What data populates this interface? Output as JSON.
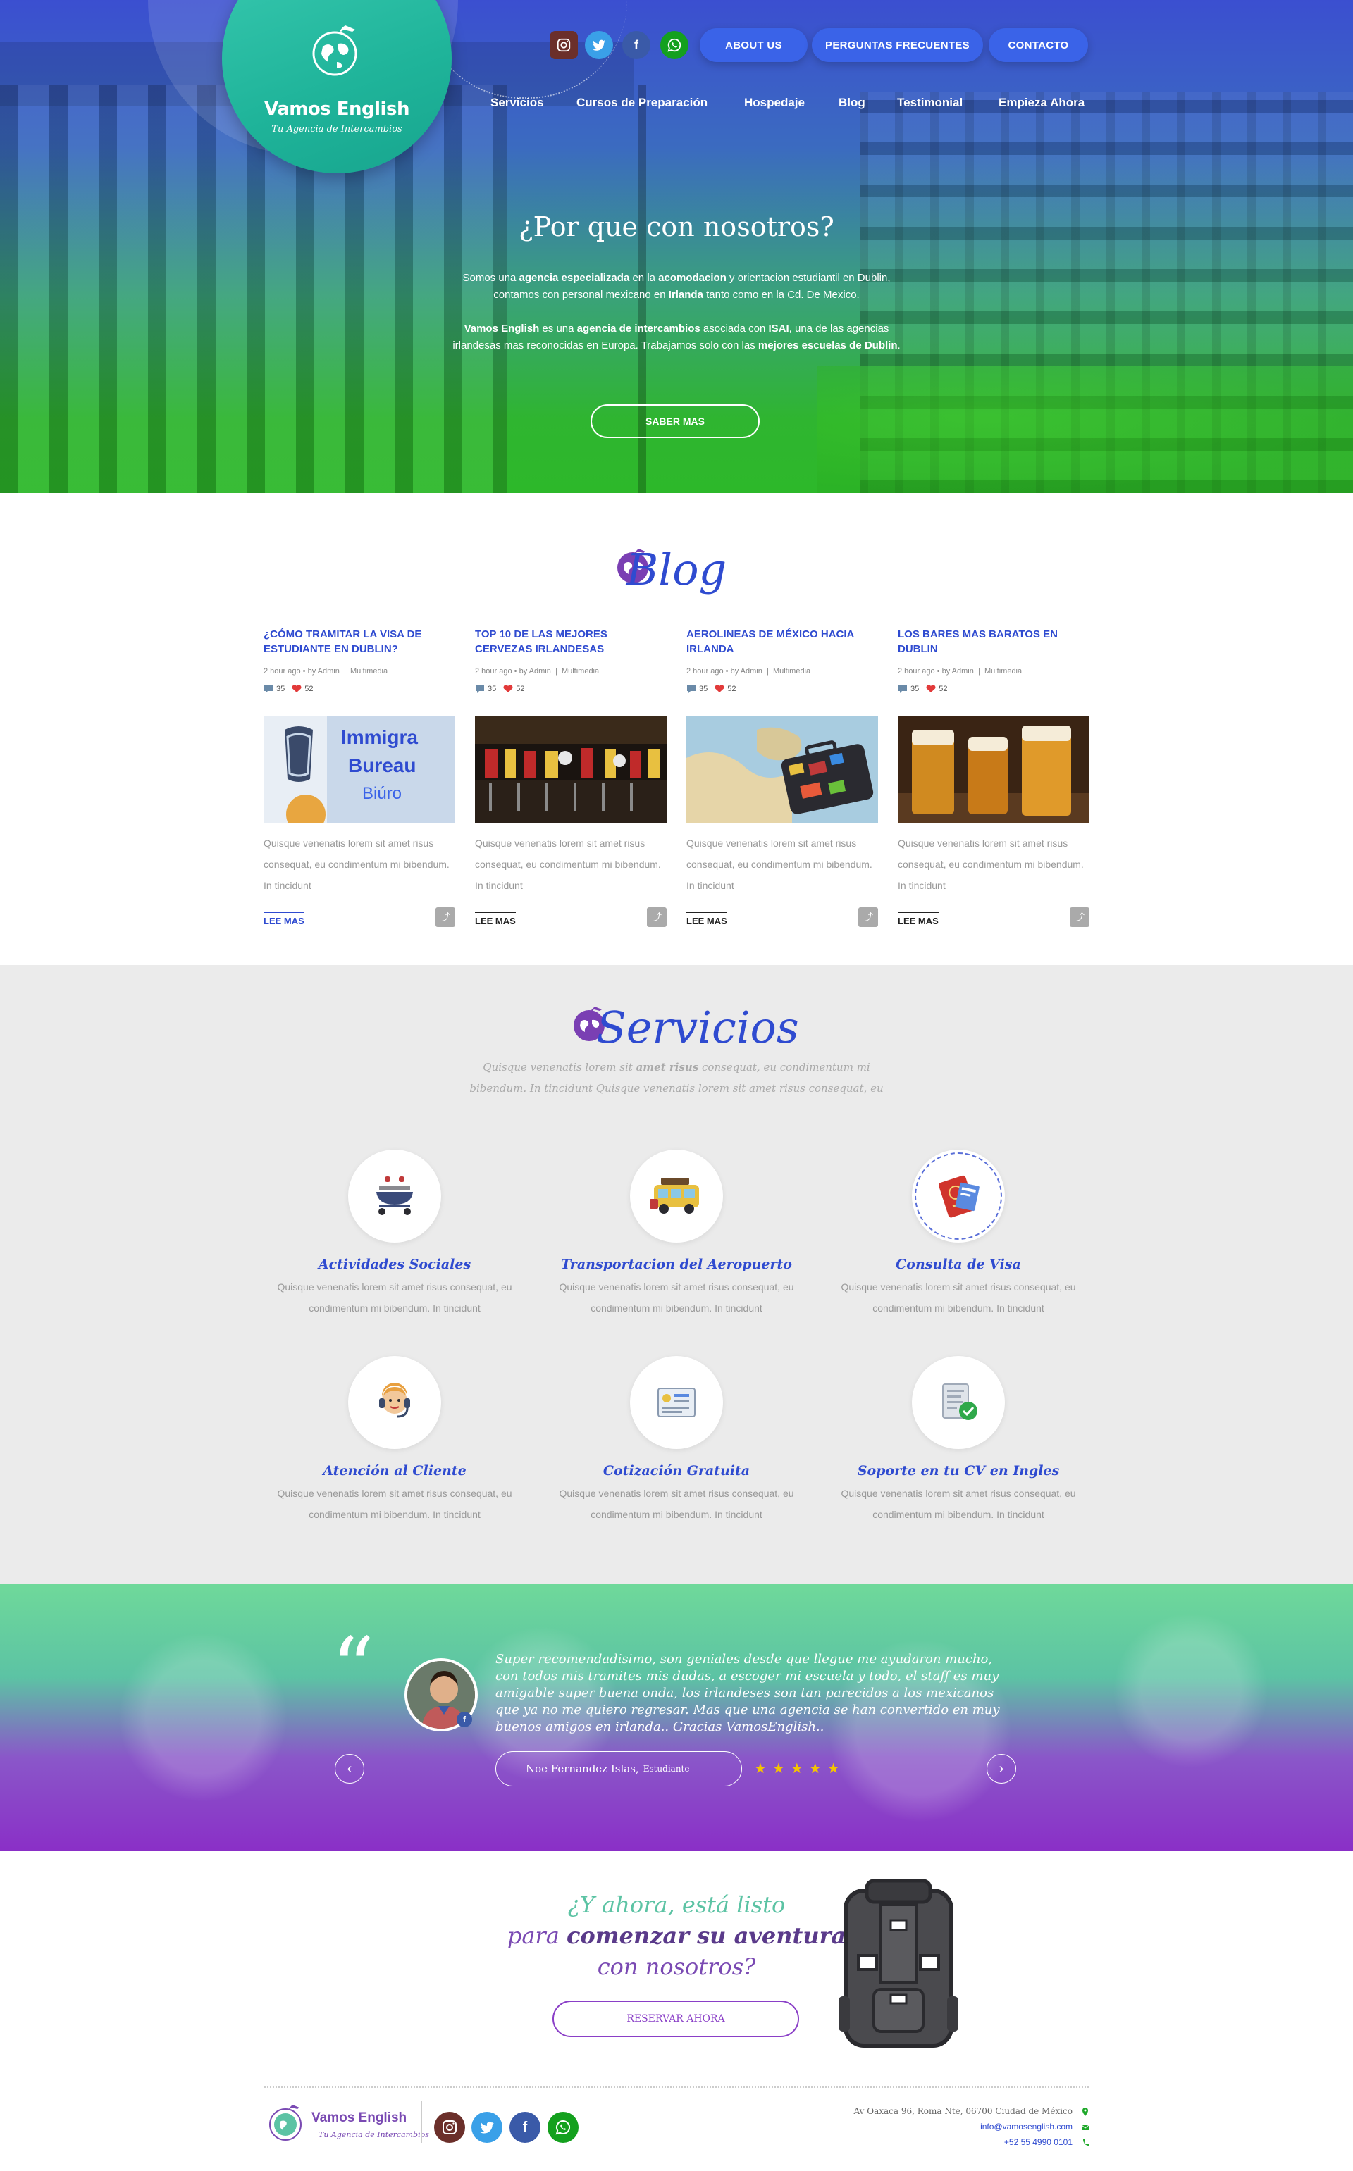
{
  "brand": {
    "name": "Vamos English",
    "tagline": "Tu Agencia de Intercambios"
  },
  "header": {
    "social_icons": [
      "instagram-icon",
      "twitter-icon",
      "facebook-icon",
      "whatsapp-icon"
    ],
    "buttons": {
      "about": "ABOUT US",
      "faq": "PERGUNTAS FRECUENTES",
      "contact": "CONTACTO"
    },
    "nav": [
      "Servicios",
      "Cursos de Preparación",
      "Hospedaje",
      "Blog",
      "Testimonial",
      "Empieza Ahora"
    ]
  },
  "hero": {
    "title": "¿Por que con nosotros?",
    "p1": {
      "parts": [
        "Somos una ",
        "agencia especializada",
        " en la ",
        "acomodacion",
        " y orientacion estudiantil en Dublin, contamos con personal mexicano en ",
        "Irlanda",
        " tanto como en la Cd. De Mexico."
      ]
    },
    "p2": {
      "parts": [
        "Vamos English",
        " es una ",
        "agencia de intercambios",
        " asociada con ",
        "ISAI",
        ", una de las agencias irlandesas mas reconocidas en Europa. Trabajamos solo con las ",
        "mejores escuelas de Dublin",
        "."
      ]
    },
    "button": "SABER MAS"
  },
  "blog": {
    "title": "Blog",
    "posts": [
      {
        "title": "¿CÓMO TRAMITAR LA VISA DE ESTUDIANTE EN DUBLIN?",
        "time": "2 hour ago",
        "by": "by",
        "author": "Admin",
        "category": "Multimedia",
        "comments": "35",
        "likes": "52",
        "excerpt": "Quisque venenatis lorem sit amet risus consequat, eu condimentum mi bibendum. In tincidunt",
        "link": "LEE MAS"
      },
      {
        "title": "TOP 10 DE LAS MEJORES CERVEZAS IRLANDESAS",
        "time": "2 hour ago",
        "by": "by",
        "author": "Admin",
        "category": "Multimedia",
        "comments": "35",
        "likes": "52",
        "excerpt": "Quisque venenatis lorem sit amet risus consequat, eu condimentum mi bibendum. In tincidunt",
        "link": "LEE MAS"
      },
      {
        "title": "AEROLINEAS DE MÉXICO HACIA IRLANDA",
        "time": "2 hour ago",
        "by": "by",
        "author": "Admin",
        "category": "Multimedia",
        "comments": "35",
        "likes": "52",
        "excerpt": "Quisque venenatis lorem sit amet risus consequat, eu condimentum mi bibendum. In tincidunt",
        "link": "LEE MAS"
      },
      {
        "title": "LOS BARES MAS BARATOS EN DUBLIN",
        "time": "2 hour ago",
        "by": "by",
        "author": "Admin",
        "category": "Multimedia",
        "comments": "35",
        "likes": "52",
        "excerpt": "Quisque venenatis lorem sit amet risus consequat, eu condimentum mi bibendum. In tincidunt",
        "link": "LEE MAS"
      }
    ]
  },
  "servicios": {
    "title": "Servicios",
    "subtitle_parts": [
      "Quisque venenatis lorem sit ",
      "amet risus",
      " consequat, eu condimentum mi bibendum. In tincidunt Quisque venenatis lorem sit amet risus consequat, eu"
    ],
    "items": [
      {
        "title": "Actividades Sociales",
        "desc": "Quisque venenatis lorem sit amet risus consequat, eu condimentum mi bibendum. In tincidunt",
        "icon": "bbq-grill-icon"
      },
      {
        "title": "Transportacion del Aeropuerto",
        "desc": "Quisque venenatis lorem sit amet risus consequat, eu condimentum mi bibendum. In tincidunt",
        "icon": "van-icon"
      },
      {
        "title": "Consulta de Visa",
        "desc": "Quisque venenatis lorem sit amet risus consequat, eu condimentum mi bibendum. In tincidunt",
        "icon": "passport-icon"
      },
      {
        "title": "Atención al Cliente",
        "desc": "Quisque venenatis lorem sit amet risus consequat, eu condimentum mi bibendum. In tincidunt",
        "icon": "headset-agent-icon"
      },
      {
        "title": "Cotización Gratuita",
        "desc": "Quisque venenatis lorem sit amet risus consequat, eu condimentum mi bibendum. In tincidunt",
        "icon": "quote-sheet-icon"
      },
      {
        "title": "Soporte en tu CV en Ingles",
        "desc": "Quisque venenatis lorem sit amet risus consequat, eu condimentum mi bibendum. In tincidunt",
        "icon": "cv-check-icon"
      }
    ]
  },
  "testimonial": {
    "quote_mark": "“",
    "text": "Super recomendadisimo, son geniales desde que llegue me ayudaron mucho, con todos mis tramites mis dudas, a escoger mi escuela y todo, el staff es muy amigable super buena onda, los irlandeses son tan parecidos a los mexicanos que ya no me quiero regresar. Mas que una agencia se han convertido en muy buenos amigos en irlanda.. Gracias VamosEnglish..",
    "author": "Noe Fernandez Islas,",
    "role": "Estudiante",
    "rating": 5,
    "prev": "‹",
    "next": "›"
  },
  "cta": {
    "line1": "¿Y ahora, está listo",
    "line2_pre": "para ",
    "line2_bold": "comenzar su aventura",
    "line3": "con nosotros?",
    "button": "RESERVAR AHORA"
  },
  "footer": {
    "address": "Av Oaxaca 96, Roma Nte, 06700 Ciudad de México",
    "email": "info@vamosenglish.com",
    "phone": "+52 55 4990 0101"
  },
  "colors": {
    "primary_blue": "#2f4bd0",
    "teal": "#1fb49a",
    "purple": "#8a3fc7",
    "green": "#2db82a"
  }
}
